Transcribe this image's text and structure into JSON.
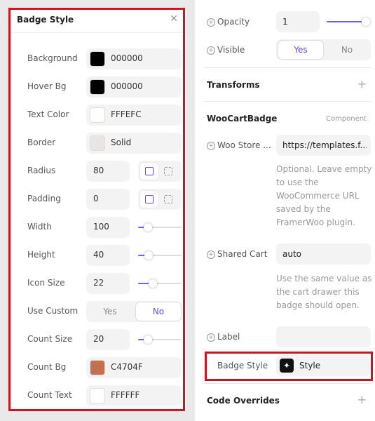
{
  "left_panel": {
    "title": "Badge Style",
    "rows": [
      {
        "label": "Background",
        "value": "000000",
        "swatch": "#000000"
      },
      {
        "label": "Hover Bg",
        "value": "000000",
        "swatch": "#000000"
      },
      {
        "label": "Text Color",
        "value": "FFFEFC",
        "swatch": "#FFFEFC"
      },
      {
        "label": "Border",
        "value": "Solid"
      },
      {
        "label": "Radius",
        "value": "80"
      },
      {
        "label": "Padding",
        "value": "0"
      },
      {
        "label": "Width",
        "value": "100",
        "slider": 0.15
      },
      {
        "label": "Height",
        "value": "40",
        "slider": 0.18
      },
      {
        "label": "Icon Size",
        "value": "22",
        "slider": 0.3
      },
      {
        "label": "Use Custom",
        "option_yes": "Yes",
        "option_no": "No",
        "selected": "No"
      },
      {
        "label": "Count Size",
        "value": "20",
        "slider": 0.15
      },
      {
        "label": "Count Bg",
        "value": "C4704F",
        "swatch": "#C4704F"
      },
      {
        "label": "Count Text",
        "value": "FFFFFF",
        "swatch": "#FFFFFF"
      }
    ]
  },
  "right_panel": {
    "opacity": {
      "label": "Opacity",
      "value": "1",
      "slider": 1.0
    },
    "visible": {
      "label": "Visible",
      "option_yes": "Yes",
      "option_no": "No",
      "selected": "Yes"
    },
    "transforms": {
      "label": "Transforms"
    },
    "component": {
      "name": "WooCartBadge",
      "tag": "Component"
    },
    "store": {
      "label": "Woo Store ...",
      "value": "https://templates.f...",
      "hint": "Optional. Leave empty to use the WooCommerce URL saved by the FramerWoo plugin."
    },
    "shared_cart": {
      "label": "Shared Cart",
      "value": "auto",
      "hint": "Use the same value as the cart drawer this badge should open."
    },
    "label": {
      "label": "Label",
      "value": ""
    },
    "badge_style": {
      "label": "Badge Style",
      "value": "Style"
    },
    "code_overrides": {
      "label": "Code Overrides"
    }
  },
  "colors": {
    "accent": "#6B46E5",
    "highlight": "#D0141F"
  }
}
